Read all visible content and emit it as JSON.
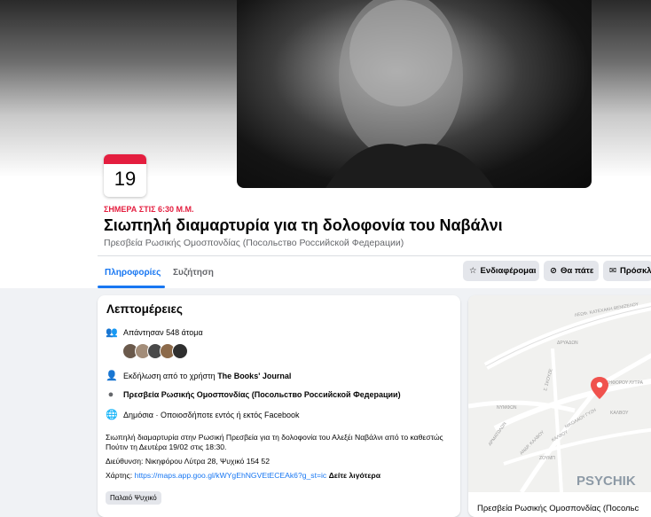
{
  "event": {
    "date_day": "19",
    "when": "ΣΗΜΕΡΑ ΣΤΙΣ 6:30 Μ.Μ.",
    "title": "Σιωπηλή διαμαρτυρία για τη δολοφονία του Ναβάλνι",
    "organizer": "Πρεσβεία Ρωσικής Ομοσπονδίας (Посольство Российской Федерации)"
  },
  "tabs": [
    {
      "label": "Πληροφορίες"
    },
    {
      "label": "Συζήτηση"
    }
  ],
  "actions": {
    "interested": "Ενδιαφέρομαι",
    "going": "Θα πάτε",
    "invite": "Πρόσκλ"
  },
  "details": {
    "heading": "Λεπτομέρειες",
    "responded": "Απάντησαν 548 άτομα",
    "host_prefix": "Εκδήλωση από το χρήστη ",
    "host_name": "The Books' Journal",
    "venue": "Πρεσβεία Ρωσικής Ομοσπονδίας (Посольство Российской Федерации)",
    "privacy": "Δημόσια · Οποιοσδήποτε εντός ή εκτός Facebook",
    "description": "Σιωπηλή διαμαρτυρία στην Ρωσική Πρεσβεία για τη δολοφονία του Αλεξέι Ναβάλνι από το καθεστώς Πούτιν τη Δευτέρα 19/02 στις 18:30.",
    "address": "Διεύθυνση: Νικηφόρου Λύτρα 28, Ψυχικό 154 52",
    "map_prefix": "Χάρτης: ",
    "map_link": "https://maps.app.goo.gl/kWYgEhNGVEtECEAk6?g_st=ic",
    "see_more": "Δείτε λιγότερα",
    "tag": "Παλαιό Ψυχικό"
  },
  "map": {
    "streets": [
      "ΛΕΩΦ. ΚΑΤΕΧΑΚΗ ΒΕΝΙΖΕΛΟΥ",
      "ΔΡΥΑΔΩΝ",
      "Σ. ΣΚΟΥΖΕ",
      "ΝΙΚΗΦΟΡΟΥ ΛΥΤΡΑ",
      "ΝΥΜΦΩΝ",
      "ΚΑΛΒΟΥ",
      "ΝΙΚΟΛΑΟΥ ΓΥΖΗ",
      "ΚΑΛΒΟΥ",
      "ΑΡΜΑΤΩΛΩΝ",
      "ΑΝΔΡ. ΚΑΛΒΟΥ",
      "ΖΟΥΜΠ"
    ],
    "area": "PSYCHIK",
    "caption": "Πρεσβεία Ρωσικής Ομοσπονδίας (Посольс",
    "pin_color": "#f0524d"
  },
  "colors": {
    "accent": "#1877f2",
    "date_red": "#e41e3f"
  }
}
